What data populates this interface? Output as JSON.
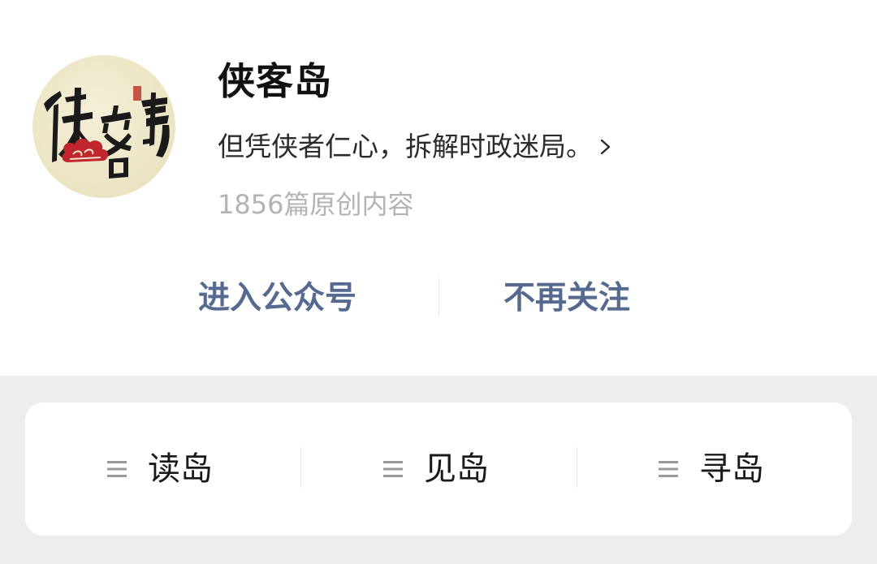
{
  "account": {
    "name": "侠客岛",
    "description": "但凭侠者仁心，拆解时政迷局。",
    "original_count": "1856篇原创内容",
    "avatar_icon": "xiakedao-calligraphy-logo"
  },
  "actions": {
    "enter_label": "进入公众号",
    "unfollow_label": "不再关注",
    "accent_color": "#56698f"
  },
  "menu": {
    "items": [
      {
        "label": "读岛",
        "icon": "menu-lines-icon"
      },
      {
        "label": "见岛",
        "icon": "menu-lines-icon"
      },
      {
        "label": "寻岛",
        "icon": "menu-lines-icon"
      }
    ]
  }
}
